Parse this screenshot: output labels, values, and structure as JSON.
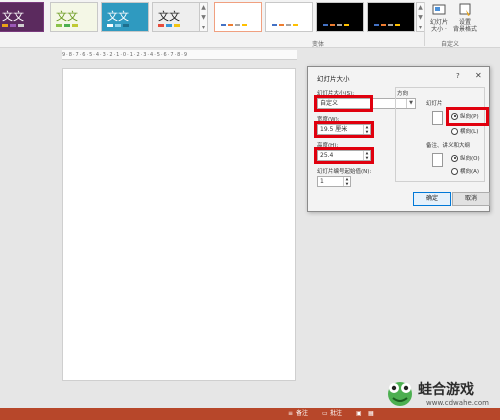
{
  "ribbon": {
    "themes": [
      {
        "text": "文文",
        "bg": "#5b2a5e",
        "fg": "#ffffff"
      },
      {
        "text": "文文",
        "bg": "#f4f7e6",
        "fg": "#6a9a1f"
      },
      {
        "text": "文文",
        "bg": "#2f9ac0",
        "fg": "#ffffff"
      },
      {
        "text": "文文",
        "bg": "#eeeeee",
        "fg": "#222222"
      }
    ],
    "variants": [
      {
        "bg": "#ffffff",
        "border": "#f0a080"
      },
      {
        "bg": "#ffffff",
        "border": "#c8c8c8"
      },
      {
        "bg": "#000000",
        "border": "#c8c8c8"
      },
      {
        "bg": "#000000",
        "border": "#c8c8c8"
      }
    ],
    "variants_group_label": "变体",
    "custom_group_label": "自定义",
    "slide_size_button": "幻灯片\n大小 ·",
    "format_bg_button": "设置\n背景格式"
  },
  "ruler": {
    "text": "9·8·7·6·5·4·3·2·1·0·1·2·3·4·5·6·7·8·9"
  },
  "dialog": {
    "title": "幻灯片大小",
    "help": "?",
    "close": "✕",
    "size_label": "幻灯片大小(S):",
    "size_value": "自定义",
    "width_label": "宽度(W):",
    "width_value": "19.5 厘米",
    "height_label": "高度(H):",
    "height_value": "25.4",
    "number_label": "幻灯片编号起始值(N):",
    "number_value": "1",
    "orientation_label": "方向",
    "slides_label": "幻灯片",
    "portrait": "纵向(P)",
    "landscape": "横向(L)",
    "notes_label": "备注、讲义和大纲",
    "notes_portrait": "纵向(O)",
    "notes_landscape": "横向(A)",
    "ok": "确定",
    "cancel": "取消"
  },
  "statusbar": {
    "notes": "备注",
    "comments": "批注"
  },
  "watermark": {
    "name": "蛙合游戏",
    "url": "www.cdwahe.com"
  },
  "colors": {
    "highlight": "#e0000e",
    "status": "#b7472a",
    "accent": "#0078d7"
  }
}
